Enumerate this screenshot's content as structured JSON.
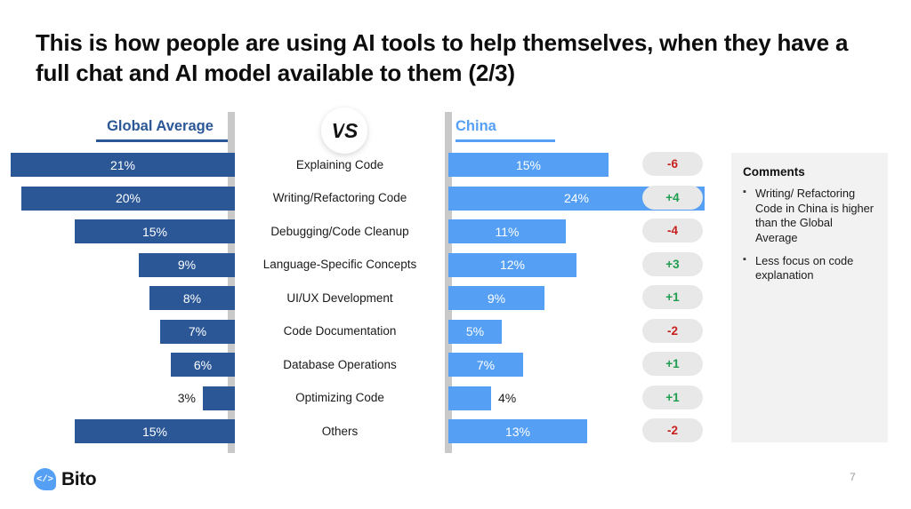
{
  "slide": {
    "title": "This is how people are using AI tools to help themselves, when they have a full chat and AI model available to them (2/3)",
    "page_number": "7"
  },
  "headers": {
    "left_label": "Global Average",
    "right_label": "China",
    "vs_label": "VS"
  },
  "colors": {
    "global_bar": "#2B5797",
    "china_bar": "#55A0F5",
    "positive_delta": "#1F9D4E",
    "negative_delta": "#C8201E",
    "pill_background": "#e8e8e8",
    "rail": "#c9c9c9",
    "comments_background": "#f2f2f2"
  },
  "comments": {
    "heading": "Comments",
    "bullets": [
      "Writing/ Refactoring Code in China is higher than the Global Average",
      "Less focus on code explanation"
    ]
  },
  "logo": {
    "mark": "</>",
    "name": "Bito"
  },
  "chart_data": {
    "type": "bar",
    "title": "This is how people are using AI tools to help themselves, when they have a full chat and AI model available to them (2/3)",
    "xlabel": "",
    "ylabel": "",
    "orientation": "horizontal-diverging",
    "xlim": [
      0,
      24
    ],
    "grid": false,
    "legend_position": "top",
    "categories": [
      "Explaining Code",
      "Writing/Refactoring Code",
      "Debugging/Code Cleanup",
      "Language-Specific Concepts",
      "UI/UX Development",
      "Code Documentation",
      "Database Operations",
      "Optimizing Code",
      "Others"
    ],
    "series": [
      {
        "name": "Global Average",
        "color": "#2B5797",
        "values": [
          21,
          20,
          15,
          9,
          8,
          7,
          6,
          3,
          15
        ],
        "labels": [
          "21%",
          "20%",
          "15%",
          "9%",
          "8%",
          "7%",
          "6%",
          "3%",
          "15%"
        ],
        "label_outside": [
          false,
          false,
          false,
          false,
          false,
          false,
          false,
          true,
          false
        ]
      },
      {
        "name": "China",
        "color": "#55A0F5",
        "values": [
          15,
          24,
          11,
          12,
          9,
          5,
          7,
          4,
          13
        ],
        "labels": [
          "15%",
          "24%",
          "11%",
          "12%",
          "9%",
          "5%",
          "7%",
          "4%",
          "13%"
        ],
        "label_outside": [
          false,
          false,
          false,
          false,
          false,
          false,
          false,
          true,
          false
        ]
      }
    ],
    "deltas": [
      "-6",
      "+4",
      "-4",
      "+3",
      "+1",
      "-2",
      "+1",
      "+1",
      "-2"
    ],
    "delta_signs": [
      "neg",
      "pos",
      "neg",
      "pos",
      "pos",
      "neg",
      "pos",
      "pos",
      "neg"
    ]
  }
}
